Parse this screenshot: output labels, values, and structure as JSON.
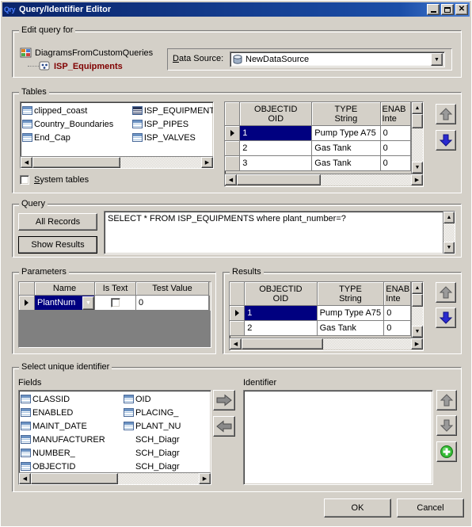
{
  "window": {
    "title": "Query/Identifier Editor",
    "icon": "Qry",
    "buttons": {
      "minimize": "minimize-icon",
      "maximize": "maximize-icon",
      "close": "close-icon"
    }
  },
  "edit_query_for": {
    "legend": "Edit query for",
    "tree": {
      "root": "DiagramsFromCustomQueries",
      "child": "ISP_Equipments"
    },
    "data_source": {
      "label": "Data Source:",
      "label_accel": "D",
      "value": "NewDataSource"
    }
  },
  "tables": {
    "legend": "Tables",
    "column1": [
      "clipped_coast",
      "Country_Boundaries",
      "End_Cap"
    ],
    "column2": [
      "ISP_EQUIPMENTS",
      "ISP_PIPES",
      "ISP_VALVES"
    ],
    "selected": "ISP_EQUIPMENTS",
    "system_tables": {
      "label": "System tables",
      "checked": false
    }
  },
  "preview_grid": {
    "columns": [
      {
        "name": "OBJECTID",
        "type": "OID"
      },
      {
        "name": "TYPE",
        "type": "String"
      },
      {
        "name": "ENAB",
        "type": "Inte"
      }
    ],
    "rows": [
      {
        "indicator": "►",
        "OBJECTID": "1",
        "TYPE": "Pump Type A75",
        "ENAB": "0",
        "selected": true
      },
      {
        "indicator": "",
        "OBJECTID": "2",
        "TYPE": "Gas Tank",
        "ENAB": "0",
        "selected": false
      },
      {
        "indicator": "",
        "OBJECTID": "3",
        "TYPE": "Gas Tank",
        "ENAB": "0",
        "selected": false
      }
    ],
    "move_up": "move-up-arrow",
    "move_down": "move-down-arrow"
  },
  "query": {
    "legend": "Query",
    "all_records_button": "All Records",
    "show_results_button": "Show Results",
    "sql": "SELECT * FROM ISP_EQUIPMENTS where plant_number=?"
  },
  "parameters": {
    "legend": "Parameters",
    "columns": [
      "",
      "Name",
      "Is Text",
      "Test Value"
    ],
    "rows": [
      {
        "indicator": "►",
        "name": "PlantNum",
        "is_text": false,
        "test_value": "0"
      }
    ]
  },
  "results": {
    "legend": "Results",
    "columns": [
      {
        "name": "OBJECTID",
        "type": "OID"
      },
      {
        "name": "TYPE",
        "type": "String"
      },
      {
        "name": "ENAB",
        "type": "Inte"
      }
    ],
    "rows": [
      {
        "indicator": "►",
        "OBJECTID": "1",
        "TYPE": "Pump Type A75",
        "ENAB": "0",
        "selected": true
      },
      {
        "indicator": "",
        "OBJECTID": "2",
        "TYPE": "Gas Tank",
        "ENAB": "0",
        "selected": false
      }
    ]
  },
  "unique_identifier": {
    "legend": "Select unique identifier",
    "fields_label": "Fields",
    "fields_column1": [
      "CLASSID",
      "ENABLED",
      "MAINT_DATE",
      "MANUFACTURER",
      "NUMBER_",
      "OBJECTID"
    ],
    "fields_column2": [
      "OID",
      "PLACING_",
      "PLANT_NU",
      "SCH_Diagr",
      "SCH_Diagr",
      "SCH_Diagr"
    ],
    "identifier_label": "Identifier",
    "identifier_items": [],
    "add_button": "right-arrow-icon",
    "remove_button": "left-arrow-icon",
    "move_up": "move-up-arrow",
    "move_down": "move-down-arrow",
    "new_field": "add-green-plus-icon"
  },
  "footer": {
    "ok": "OK",
    "cancel": "Cancel"
  },
  "colors": {
    "titlebar_start": "#0a246a",
    "titlebar_end": "#4a7fd4",
    "face": "#d4d0c8",
    "selection": "#000080",
    "tree_child_text": "#800000",
    "accent_blue": "#2222cc",
    "accent_green": "#33bb33"
  }
}
